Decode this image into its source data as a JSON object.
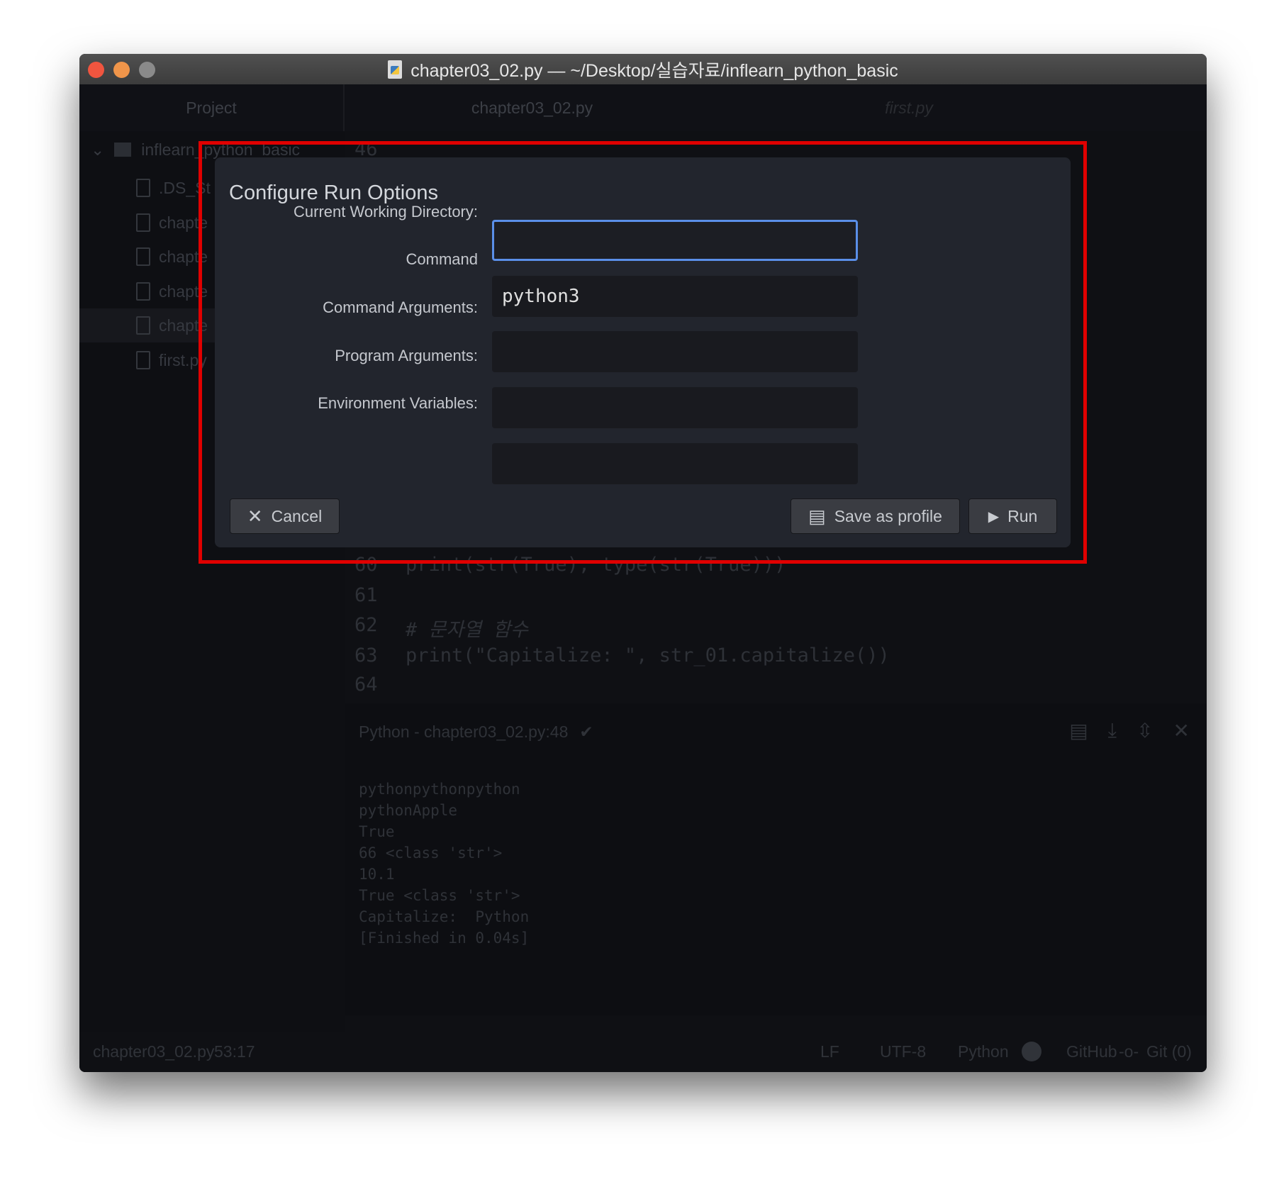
{
  "window": {
    "title": "chapter03_02.py — ~/Desktop/실습자료/inflearn_python_basic"
  },
  "tabs": {
    "project": "Project",
    "active": "chapter03_02.py",
    "inactive": "first.py"
  },
  "sidebar": {
    "root": "inflearn_python_basic",
    "items": [
      ".DS_St",
      "chapte",
      "chapte",
      "chapte",
      "chapte",
      "first.py"
    ]
  },
  "editor": {
    "lines": [
      {
        "num": "46",
        "text": ""
      },
      {
        "num": "60",
        "text": "print(str(True), type(str(True)))"
      },
      {
        "num": "61",
        "text": ""
      },
      {
        "num": "62",
        "text": "# 문자열 함수"
      },
      {
        "num": "63",
        "text": "print(\"Capitalize: \", str_01.capitalize())"
      },
      {
        "num": "64",
        "text": ""
      }
    ]
  },
  "panel": {
    "title": "Python - chapter03_02.py:48",
    "output": [
      "pythonpythonpython",
      "pythonApple",
      "True",
      "66 <class 'str'>",
      "10.1",
      "True <class 'str'>",
      "Capitalize:  Python",
      "[Finished in 0.04s]"
    ]
  },
  "status": {
    "file": "chapter03_02.py",
    "cursor": "53:17",
    "eol": "LF",
    "encoding": "UTF-8",
    "grammar": "Python",
    "github": "GitHub",
    "git": "Git (0)"
  },
  "dialog": {
    "title": "Configure Run Options",
    "cwd_label": "Current Working Directory:",
    "cwd_value": "",
    "command_label": "Command",
    "command_value": "python3",
    "cmd_args_label": "Command Arguments:",
    "cmd_args_value": "",
    "prog_args_label": "Program Arguments:",
    "prog_args_value": "",
    "env_label": "Environment Variables:",
    "env_value": "",
    "cancel": "Cancel",
    "save_profile": "Save as profile",
    "run": "Run"
  },
  "colors": {
    "highlight": "#e00000",
    "focus": "#5a8fe8"
  }
}
